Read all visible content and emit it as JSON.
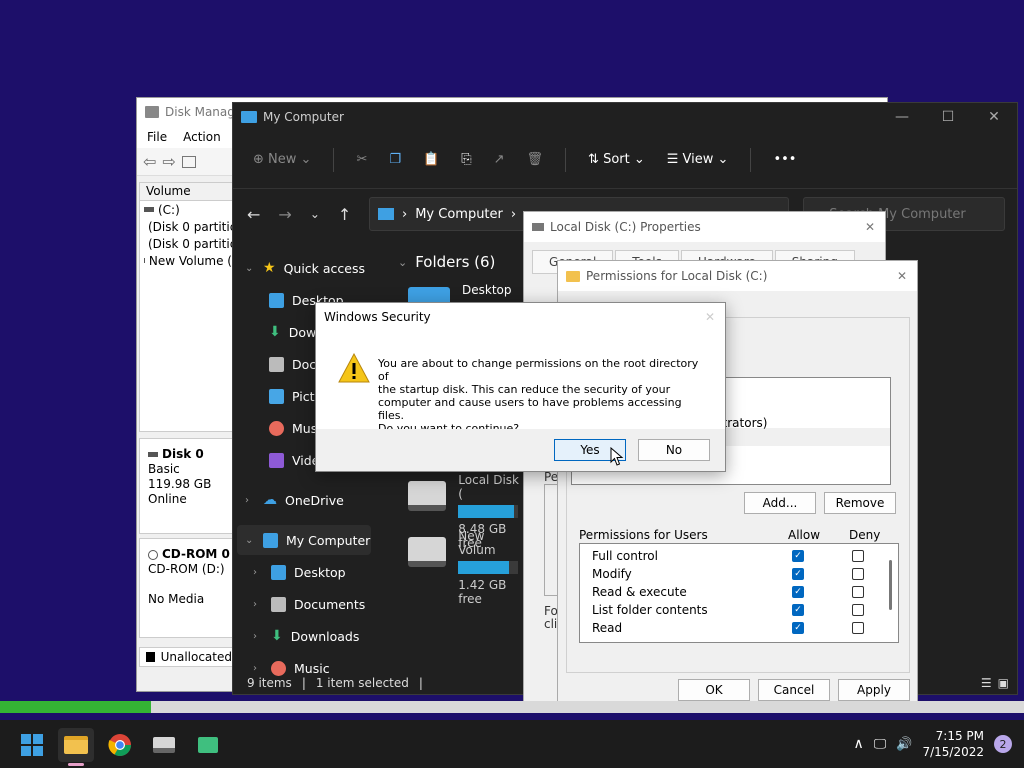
{
  "disk_mgmt": {
    "title": "Disk Manage",
    "menu": [
      "File",
      "Action"
    ],
    "volume_header": "Volume",
    "volumes": [
      "(C:)",
      "(Disk 0 partitic",
      "(Disk 0 partitic",
      "New Volume ("
    ],
    "disk0": {
      "name": "Disk 0",
      "type": "Basic",
      "size": "119.98 GB",
      "status": "Online"
    },
    "cdrom": {
      "name": "CD-ROM 0",
      "label": "CD-ROM (D:)",
      "media": "No Media"
    },
    "unallocated": "Unallocated"
  },
  "explorer": {
    "title": "My Computer",
    "cmd": {
      "new": "New",
      "sort": "Sort",
      "view": "View",
      "more": "•••"
    },
    "address": "My Computer",
    "search_placeholder": "Search My Computer",
    "nav": {
      "quick_access": "Quick access",
      "desktop": "Desktop",
      "downloads_short": "Dow",
      "documents_short": "Docu",
      "pictures_short": "Pictu",
      "music_short": "Musi",
      "videos_short": "Vide",
      "onedrive": "OneDrive",
      "my_computer": "My Computer",
      "mc_desktop": "Desktop",
      "mc_documents": "Documents",
      "mc_downloads": "Downloads",
      "mc_music": "Music"
    },
    "folders_heading": "Folders (6)",
    "folder_desktop": "Desktop",
    "drives": [
      {
        "name": "Local Disk (",
        "free": "8.48 GB free",
        "used_fraction": 0.93
      },
      {
        "name": "New Volum",
        "free": "1.42 GB free",
        "used_fraction": 0.85
      }
    ],
    "status": {
      "items": "9 items",
      "selected": "1 item selected"
    }
  },
  "properties": {
    "title": "Local Disk (C:) Properties",
    "tabs": [
      "General",
      "Tools",
      "Hardware",
      "Sharing"
    ],
    "frag_per": "Pe",
    "frag_for": "For",
    "frag_clic": "clic"
  },
  "permissions": {
    "title": "Permissions for Local Disk (C:)",
    "group_fragment": "inistrators)",
    "add_button": "Add...",
    "remove_button": "Remove",
    "perm_heading": "Permissions for Users",
    "allow": "Allow",
    "deny": "Deny",
    "rows": [
      {
        "name": "Full control",
        "allow": true,
        "deny": false
      },
      {
        "name": "Modify",
        "allow": true,
        "deny": false
      },
      {
        "name": "Read & execute",
        "allow": true,
        "deny": false
      },
      {
        "name": "List folder contents",
        "allow": true,
        "deny": false
      },
      {
        "name": "Read",
        "allow": true,
        "deny": false
      }
    ],
    "ok": "OK",
    "cancel": "Cancel",
    "apply": "Apply"
  },
  "security_dialog": {
    "title": "Windows Security",
    "message_line1": "You are about to change permissions on the root directory of",
    "message_line2": "the startup disk. This can reduce the security of your",
    "message_line3": "computer and cause users to have problems accessing files.",
    "message_line4": "Do you want to continue?",
    "yes": "Yes",
    "no": "No"
  },
  "progress": {
    "fraction": 0.147
  },
  "taskbar": {
    "apps": [
      "start-icon",
      "file-explorer-icon",
      "chrome-icon",
      "disk-mgmt-icon",
      "app-icon"
    ],
    "time": "7:15 PM",
    "date": "7/15/2022",
    "notifications": "2"
  },
  "colors": {
    "accent": "#0067c0",
    "desktop": "#1d0f6a",
    "progress": "#34b434"
  }
}
